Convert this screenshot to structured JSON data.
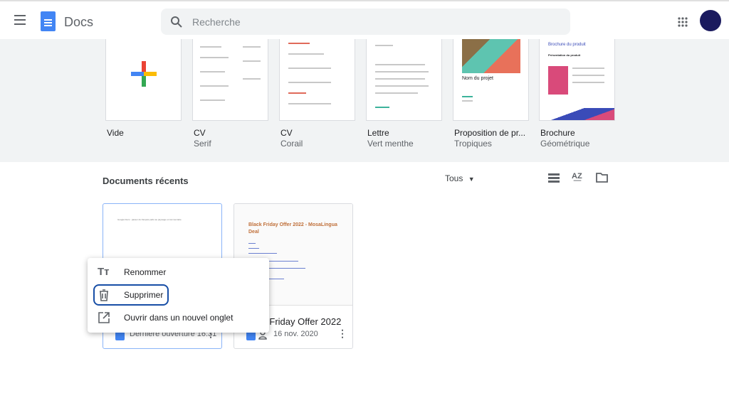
{
  "header": {
    "app_name": "Docs",
    "search_placeholder": "Recherche"
  },
  "templates": [
    {
      "name": "Vide",
      "sub": ""
    },
    {
      "name": "CV",
      "sub": "Serif"
    },
    {
      "name": "CV",
      "sub": "Corail"
    },
    {
      "name": "Lettre",
      "sub": "Vert menthe"
    },
    {
      "name": "Proposition de pr...",
      "sub": "Tropiques"
    },
    {
      "name": "Brochure",
      "sub": "Géométrique"
    }
  ],
  "template_thumbs": {
    "project_name": "Nom du projet",
    "brochure_title": "Brochure du produit",
    "brochure_sub": "Présentation du produit"
  },
  "recent": {
    "title": "Documents récents",
    "filter": "Tous"
  },
  "docs": [
    {
      "title": "",
      "meta": "Dernière ouverture 16:31",
      "preview": "Google Docs : passer du français parlé au paysage et commentaire"
    },
    {
      "title": "Black Friday Offer 2022 -...",
      "meta": "16 nov. 2020",
      "preview": "Black Friday Offer 2022 - MosaLingua Deal"
    }
  ],
  "context_menu": [
    {
      "label": "Renommer",
      "icon": "text-format-icon"
    },
    {
      "label": "Supprimer",
      "icon": "trash-icon"
    },
    {
      "label": "Ouvrir dans un nouvel onglet",
      "icon": "open-in-new-icon"
    }
  ],
  "colors": {
    "accent": "#4285f4",
    "focus": "#174ea6",
    "avatar": "#1a1a5e"
  }
}
